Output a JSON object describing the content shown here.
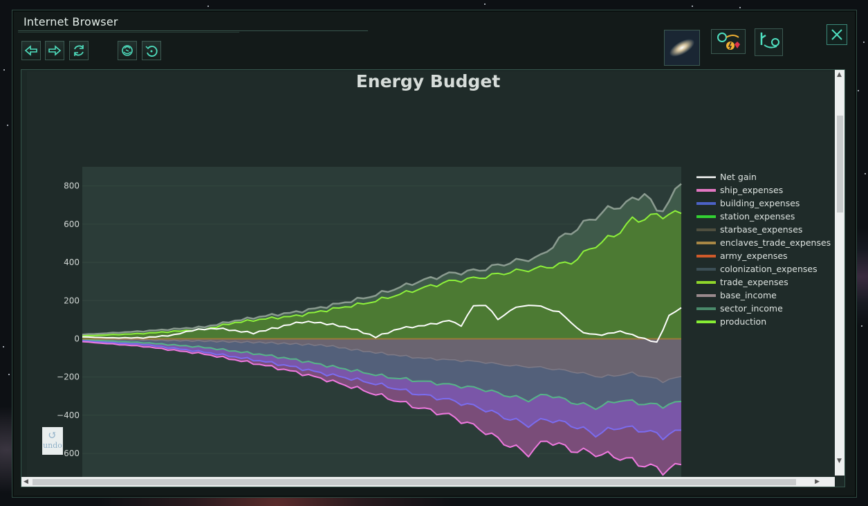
{
  "window": {
    "title": "Internet Browser"
  },
  "toolbar": {
    "icons": [
      "back-arrow-icon",
      "forward-arrow-icon",
      "reload-icon",
      "empire-emblem-icon",
      "history-icon"
    ]
  },
  "top_right": {
    "icons": [
      "galaxy-icon",
      "resource-trade-icon",
      "pop-figure-icon",
      "close-icon"
    ]
  },
  "undo": {
    "label": "undo"
  },
  "colors": {
    "window_border": "#2f4b43",
    "plot_background": "#2b3c38",
    "net_gain": "#ffffff",
    "production": "#8ef23a",
    "production_fill": "#4c7a33",
    "ship_expenses": "#f079e0",
    "building_expenses": "#7b6cf0",
    "station_expenses": "#29d13a",
    "sector_income": "#56b588"
  },
  "chart_data": {
    "type": "area",
    "title": "Energy Budget",
    "xlabel": "",
    "ylabel": "",
    "ylim": [
      -730,
      900
    ],
    "yticks": [
      "800",
      "600",
      "400",
      "200",
      "0",
      "−200",
      "−400",
      "−600"
    ],
    "ytick_values": [
      800,
      600,
      400,
      200,
      0,
      -200,
      -400,
      -600
    ],
    "legend": [
      "Net gain",
      "ship_expenses",
      "building_expenses",
      "station_expenses",
      "starbase_expenses",
      "enclaves_trade_expenses",
      "army_expenses",
      "colonization_expenses",
      "trade_expenses",
      "base_income",
      "sector_income",
      "production"
    ],
    "legend_colors": [
      "#ffffff",
      "#e377c2",
      "#4c62c6",
      "#33d133",
      "#4f4f3f",
      "#a88745",
      "#cf5a2a",
      "#3c4f56",
      "#8fd62a",
      "#9a8a8d",
      "#4a8a6a",
      "#86ee34"
    ],
    "legend_position": "right",
    "n_points": 99,
    "series": [
      {
        "name": "production",
        "anchors": [
          [
            0,
            15
          ],
          [
            10,
            28
          ],
          [
            20,
            50
          ],
          [
            25,
            85
          ],
          [
            30,
            105
          ],
          [
            35,
            120
          ],
          [
            40,
            150
          ],
          [
            47,
            190
          ],
          [
            55,
            260
          ],
          [
            60,
            300
          ],
          [
            65,
            320
          ],
          [
            70,
            350
          ],
          [
            75,
            370
          ],
          [
            80,
            400
          ],
          [
            84,
            490
          ],
          [
            87,
            540
          ],
          [
            90,
            620
          ],
          [
            95,
            650
          ],
          [
            98,
            655
          ]
        ]
      },
      {
        "name": "sector_income",
        "anchors": [
          [
            0,
            22
          ],
          [
            10,
            40
          ],
          [
            20,
            62
          ],
          [
            25,
            95
          ],
          [
            30,
            120
          ],
          [
            35,
            140
          ],
          [
            40,
            170
          ],
          [
            47,
            220
          ],
          [
            55,
            300
          ],
          [
            60,
            340
          ],
          [
            65,
            360
          ],
          [
            70,
            400
          ],
          [
            75,
            430
          ],
          [
            78,
            520
          ],
          [
            82,
            600
          ],
          [
            85,
            660
          ],
          [
            88,
            700
          ],
          [
            90,
            720
          ],
          [
            92,
            770
          ],
          [
            94,
            660
          ],
          [
            96,
            720
          ],
          [
            98,
            810
          ]
        ]
      },
      {
        "name": "Net gain",
        "anchors": [
          [
            0,
            10
          ],
          [
            5,
            5
          ],
          [
            10,
            5
          ],
          [
            15,
            20
          ],
          [
            18,
            45
          ],
          [
            22,
            55
          ],
          [
            28,
            30
          ],
          [
            32,
            60
          ],
          [
            36,
            90
          ],
          [
            40,
            80
          ],
          [
            44,
            55
          ],
          [
            48,
            10
          ],
          [
            52,
            55
          ],
          [
            56,
            70
          ],
          [
            60,
            95
          ],
          [
            62,
            70
          ],
          [
            64,
            170
          ],
          [
            66,
            180
          ],
          [
            68,
            100
          ],
          [
            70,
            150
          ],
          [
            73,
            180
          ],
          [
            76,
            160
          ],
          [
            78,
            140
          ],
          [
            82,
            30
          ],
          [
            85,
            20
          ],
          [
            88,
            40
          ],
          [
            90,
            20
          ],
          [
            94,
            -20
          ],
          [
            96,
            120
          ],
          [
            98,
            160
          ]
        ]
      },
      {
        "name": "ship_expenses",
        "anchors": [
          [
            0,
            -15
          ],
          [
            10,
            -40
          ],
          [
            20,
            -80
          ],
          [
            25,
            -110
          ],
          [
            30,
            -140
          ],
          [
            35,
            -175
          ],
          [
            40,
            -215
          ],
          [
            45,
            -260
          ],
          [
            50,
            -310
          ],
          [
            55,
            -360
          ],
          [
            60,
            -400
          ],
          [
            65,
            -470
          ],
          [
            70,
            -560
          ],
          [
            73,
            -600
          ],
          [
            76,
            -530
          ],
          [
            80,
            -580
          ],
          [
            84,
            -600
          ],
          [
            88,
            -620
          ],
          [
            92,
            -660
          ],
          [
            95,
            -690
          ],
          [
            98,
            -660
          ]
        ]
      },
      {
        "name": "building_expenses",
        "anchors": [
          [
            0,
            -10
          ],
          [
            10,
            -30
          ],
          [
            20,
            -70
          ],
          [
            25,
            -95
          ],
          [
            30,
            -120
          ],
          [
            35,
            -150
          ],
          [
            40,
            -185
          ],
          [
            45,
            -215
          ],
          [
            50,
            -250
          ],
          [
            55,
            -290
          ],
          [
            60,
            -320
          ],
          [
            65,
            -360
          ],
          [
            70,
            -420
          ],
          [
            73,
            -450
          ],
          [
            76,
            -420
          ],
          [
            80,
            -450
          ],
          [
            84,
            -500
          ],
          [
            88,
            -460
          ],
          [
            92,
            -480
          ],
          [
            95,
            -510
          ],
          [
            98,
            -480
          ]
        ]
      },
      {
        "name": "station_expenses",
        "anchors": [
          [
            0,
            -5
          ],
          [
            10,
            -20
          ],
          [
            20,
            -45
          ],
          [
            25,
            -65
          ],
          [
            30,
            -85
          ],
          [
            35,
            -110
          ],
          [
            40,
            -140
          ],
          [
            45,
            -170
          ],
          [
            50,
            -200
          ],
          [
            55,
            -220
          ],
          [
            60,
            -240
          ],
          [
            65,
            -260
          ],
          [
            70,
            -300
          ],
          [
            73,
            -320
          ],
          [
            76,
            -290
          ],
          [
            80,
            -330
          ],
          [
            84,
            -360
          ],
          [
            88,
            -320
          ],
          [
            92,
            -340
          ],
          [
            95,
            -350
          ],
          [
            98,
            -330
          ]
        ]
      },
      {
        "name": "base_income",
        "anchors": [
          [
            0,
            -2
          ],
          [
            10,
            -6
          ],
          [
            20,
            -12
          ],
          [
            30,
            -20
          ],
          [
            40,
            -35
          ],
          [
            45,
            -60
          ],
          [
            50,
            -80
          ],
          [
            55,
            -100
          ],
          [
            60,
            -110
          ],
          [
            65,
            -120
          ],
          [
            70,
            -140
          ],
          [
            75,
            -150
          ],
          [
            80,
            -170
          ],
          [
            85,
            -200
          ],
          [
            90,
            -180
          ],
          [
            95,
            -220
          ],
          [
            98,
            -200
          ]
        ]
      }
    ]
  }
}
